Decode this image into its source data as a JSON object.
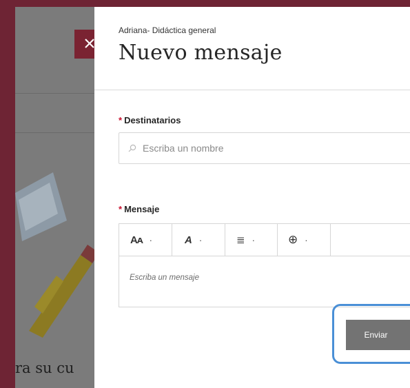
{
  "background": {
    "partial_text": "ra su cu"
  },
  "panel": {
    "subtitle": "Adriana- Didáctica general",
    "title": "Nuevo mensaje",
    "close_icon": "close-icon"
  },
  "recipients": {
    "required_mark": "*",
    "label": "Destinatarios",
    "placeholder": "Escriba un nombre",
    "icon": "search-icon"
  },
  "message": {
    "required_mark": "*",
    "label": "Mensaje",
    "placeholder": "Escriba un mensaje",
    "toolbar": [
      {
        "icon": "font-size-icon",
        "text": "Aᴀ",
        "caret": "·"
      },
      {
        "icon": "clear-format-icon",
        "text": "A",
        "caret": "·"
      },
      {
        "icon": "list-icon",
        "text": "≣",
        "caret": "·"
      },
      {
        "icon": "insert-icon",
        "text": "⊕",
        "caret": "·"
      }
    ]
  },
  "actions": {
    "send_label": "Enviar"
  },
  "colors": {
    "backdrop": "#6e2434",
    "required": "#c8102e",
    "highlight": "#4a8fd6",
    "send_button": "#737373"
  }
}
